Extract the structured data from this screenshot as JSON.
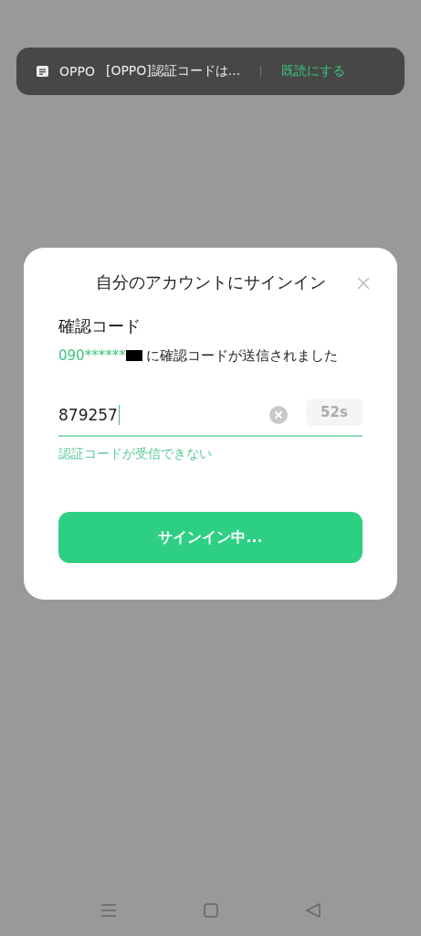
{
  "notification": {
    "app": "OPPO",
    "message": "[OPPO]認証コードは...",
    "action": "既読にする"
  },
  "dialog": {
    "title": "自分のアカウントにサインイン",
    "heading": "確認コード",
    "phone": "090******",
    "sent_text": "に確認コードが送信されました",
    "code_value": "879257",
    "countdown": "52s",
    "help_link": "認証コードが受信できない",
    "submit": "サインイン中..."
  }
}
